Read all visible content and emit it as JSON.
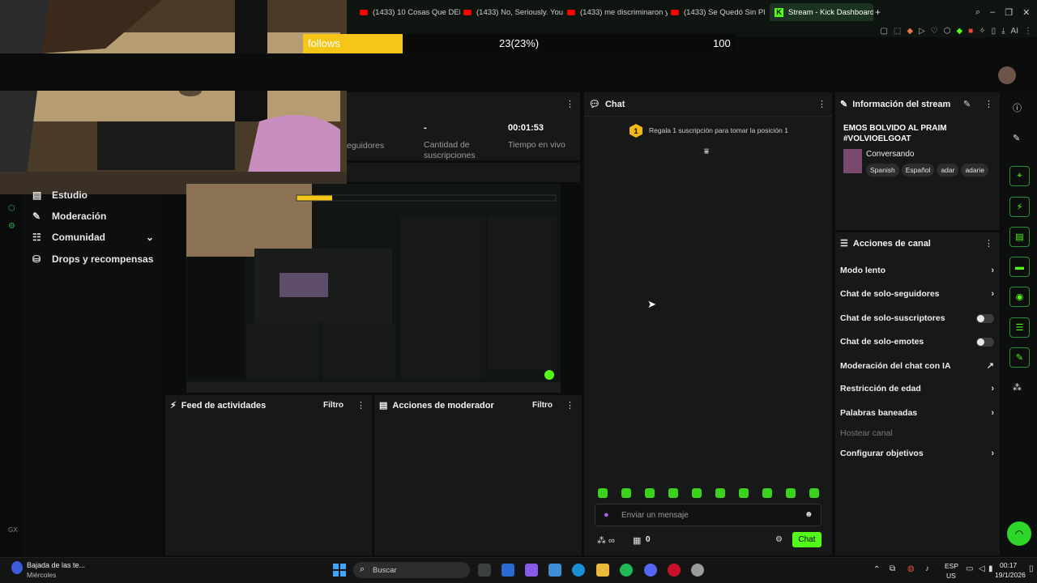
{
  "browser": {
    "tabs": [
      {
        "label": "(1433) 10 Cosas Que DEB",
        "active": false
      },
      {
        "label": "(1433) No, Seriously. You",
        "active": false
      },
      {
        "label": "(1433) me discriminaron y",
        "active": false
      },
      {
        "label": "(1433) Se Quedó Sin Plata",
        "active": false
      },
      {
        "label": "Stream - Kick Dashboard",
        "active": true
      }
    ],
    "new_tab": "+",
    "ai_label": "AI"
  },
  "goal_overlay": {
    "label": "follows",
    "count_text": "23(23%)",
    "target": "100",
    "progress_fraction": 0.23,
    "fill_color": "#f5c518"
  },
  "sidebar": {
    "items": [
      {
        "label": "Estudio",
        "icon": "studio-icon"
      },
      {
        "label": "Moderación",
        "icon": "wrench-icon"
      },
      {
        "label": "Comunidad",
        "icon": "people-icon"
      },
      {
        "label": "Drops y recompensas",
        "icon": "gift-icon"
      }
    ],
    "footer_label": "GX"
  },
  "stats": {
    "followers_label": "eguidores",
    "subs_value": "-",
    "subs_label": "Cantidad de suscripciones",
    "live_time_value": "00:01:53",
    "live_time_label": "Tiempo en vivo"
  },
  "chat": {
    "title": "Chat",
    "gift_badge": "1",
    "gift_text": "Regala 1 suscripción para tomar la posición 1",
    "input_placeholder": "Enviar un mensaje",
    "viewers": "0",
    "send_label": "Chat"
  },
  "stream_info": {
    "title": "Información del stream",
    "stream_title": "EMOS BOLVIDO AL PRAIM #VOLVIOELGOAT",
    "category": "Conversando",
    "tags": [
      "Spanish",
      "Español",
      "adar",
      "adarie"
    ]
  },
  "channel_actions": {
    "title": "Acciones de canal",
    "items": [
      {
        "label": "Modo lento",
        "control": "chevron"
      },
      {
        "label": "Chat de solo-seguidores",
        "control": "chevron"
      },
      {
        "label": "Chat de solo-suscriptores",
        "control": "toggle"
      },
      {
        "label": "Chat de solo-emotes",
        "control": "toggle"
      },
      {
        "label": "Moderación del chat con IA",
        "control": "external"
      },
      {
        "label": "Restricción de edad",
        "control": "chevron"
      },
      {
        "label": "Palabras baneadas",
        "control": "chevron"
      },
      {
        "label": "Hostear canal",
        "control": "none"
      },
      {
        "label": "Configurar objetivos",
        "control": "chevron"
      }
    ]
  },
  "feed": {
    "title": "Feed de actividades",
    "filter": "Filtro"
  },
  "mod_actions": {
    "title": "Acciones de moderador",
    "filter": "Filtro"
  },
  "taskbar": {
    "weather_title": "Bajada de las te...",
    "weather_sub": "Miércoles",
    "search": "Buscar",
    "lang": "ESP",
    "lang_sub": "US",
    "time": "00:17",
    "date": "19/1/2026"
  },
  "colors": {
    "accent": "#53fc18",
    "panel": "#161918",
    "background": "#0b0d0c"
  }
}
